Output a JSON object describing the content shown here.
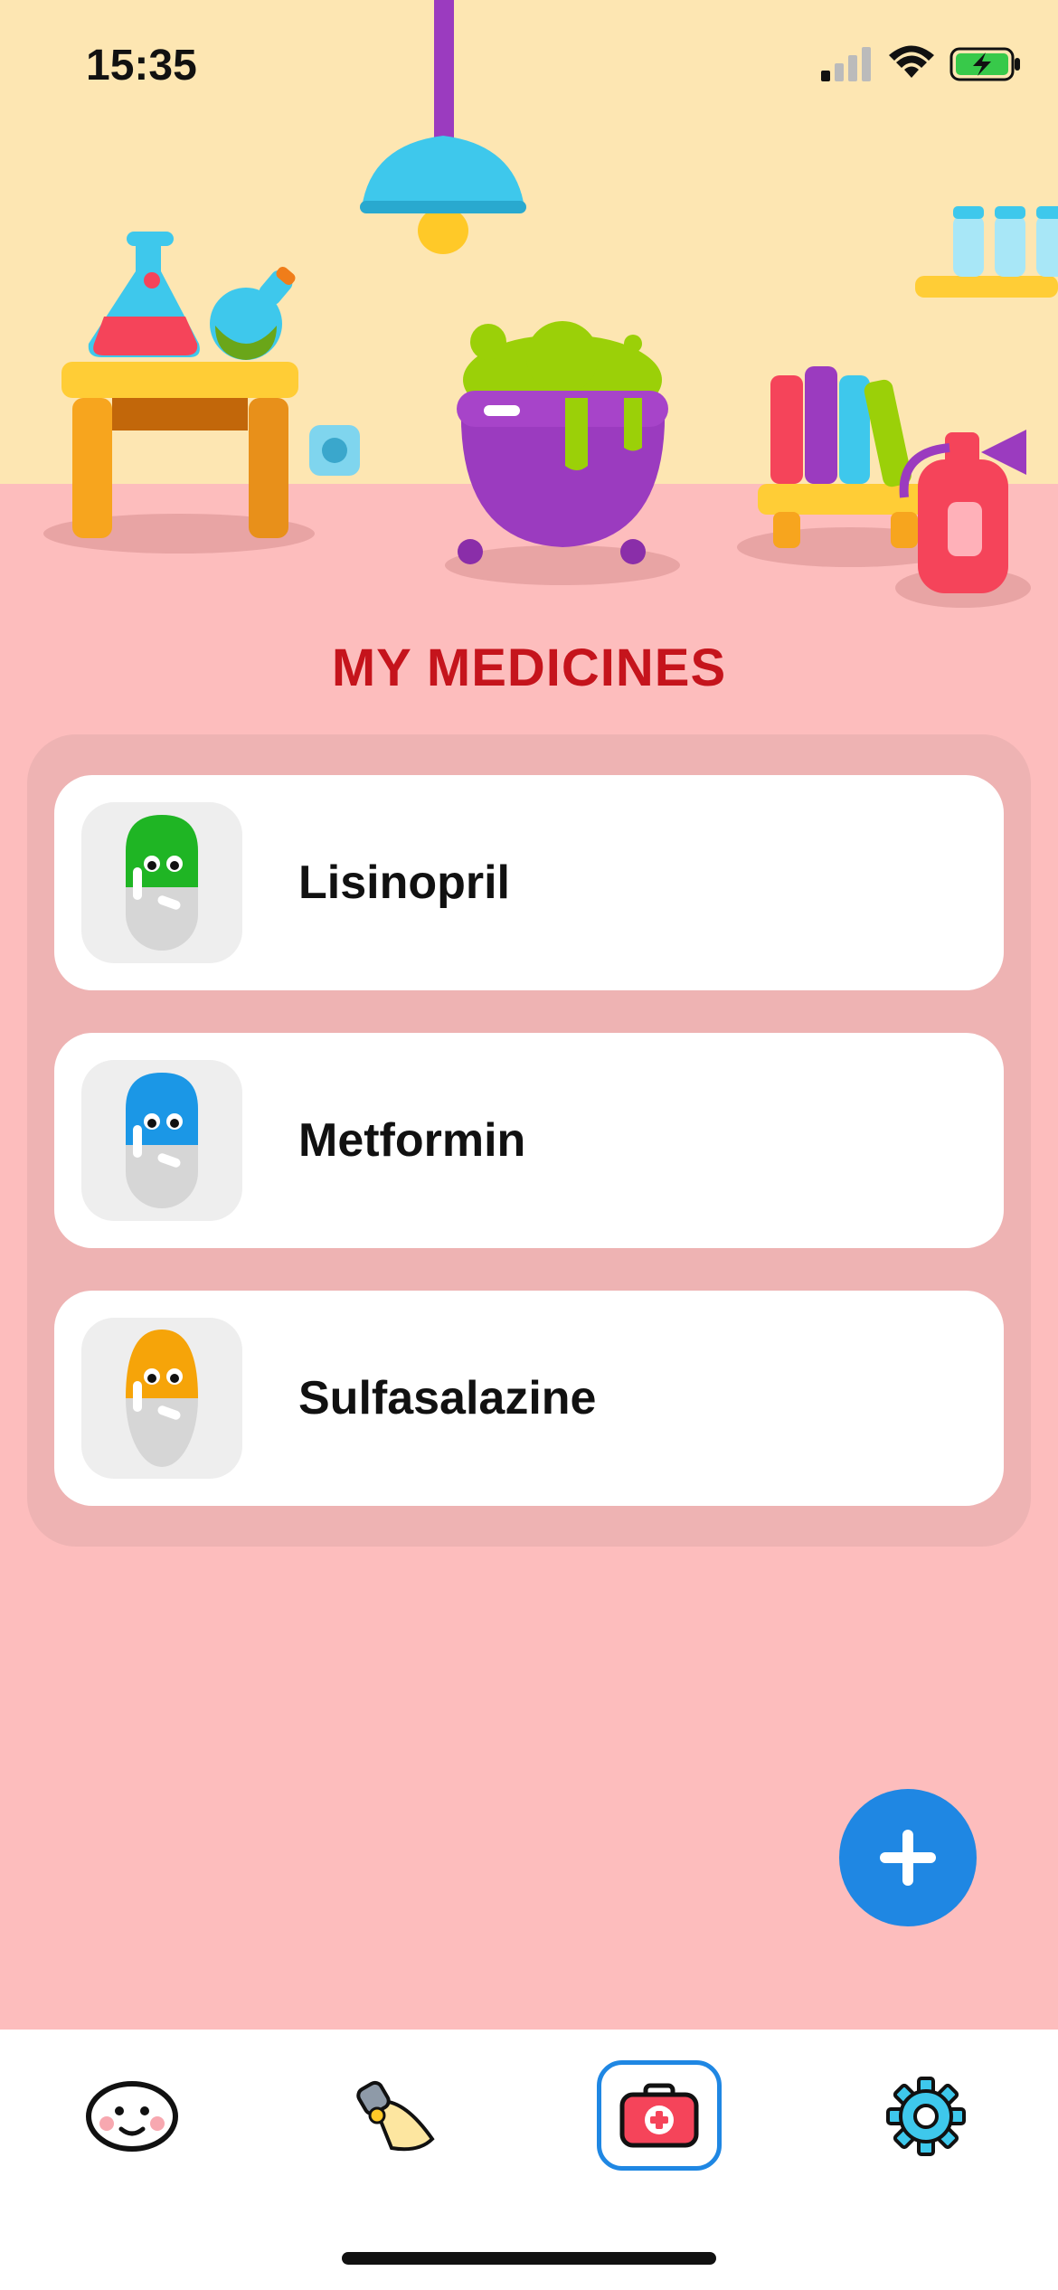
{
  "status_bar": {
    "time": "15:35"
  },
  "screen": {
    "title": "MY MEDICINES"
  },
  "medicines": [
    {
      "name": "Lisinopril",
      "pill_color": "#1fb524"
    },
    {
      "name": "Metformin",
      "pill_color": "#1b97e6"
    },
    {
      "name": "Sulfasalazine",
      "pill_color": "#f6a409"
    }
  ],
  "tabs": [
    {
      "icon": "face-icon",
      "active": false
    },
    {
      "icon": "lamp-icon",
      "active": false
    },
    {
      "icon": "medkit-icon",
      "active": true
    },
    {
      "icon": "gear-icon",
      "active": false
    }
  ],
  "colors": {
    "accent": "#1f87e3",
    "title": "#c5141c",
    "floor": "#fdbdbd",
    "wall": "#fde6b2"
  }
}
